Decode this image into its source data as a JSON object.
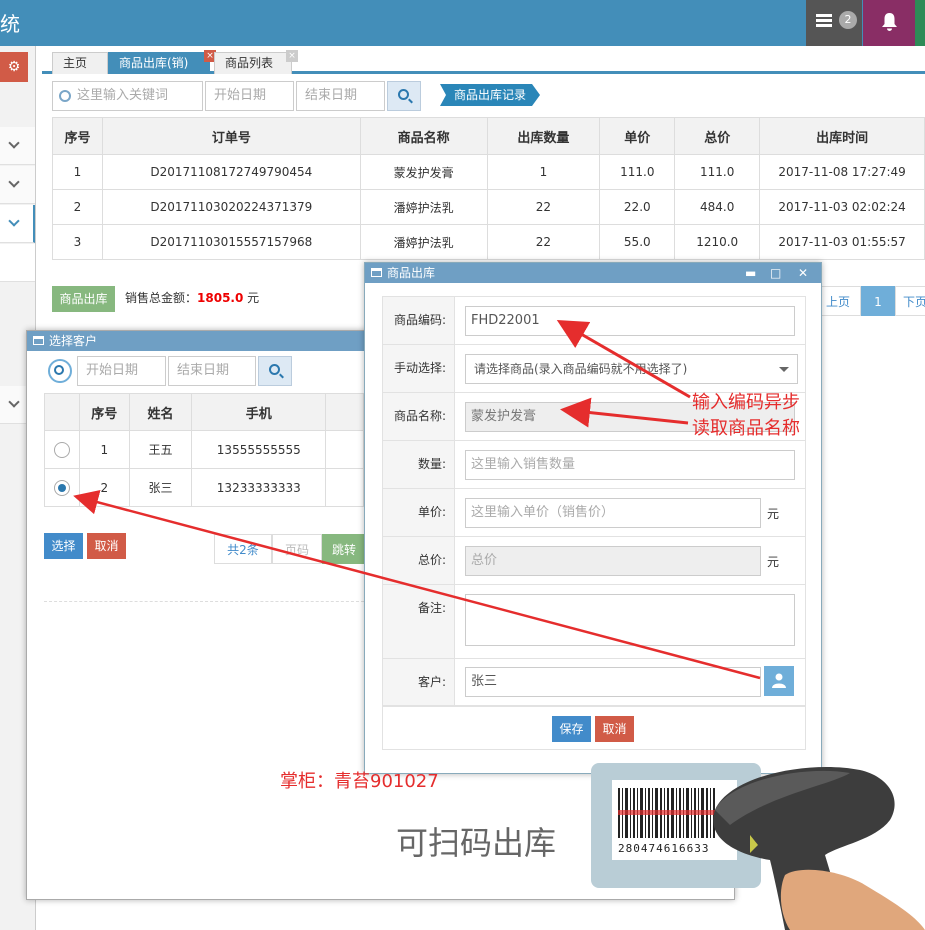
{
  "header": {
    "title": "统",
    "msg_badge": "2"
  },
  "tabs": [
    {
      "label": "主页"
    },
    {
      "label": "商品出库(销)"
    },
    {
      "label": "商品列表"
    }
  ],
  "search": {
    "keyword_placeholder": "这里输入关键词",
    "start_placeholder": "开始日期",
    "end_placeholder": "结束日期",
    "record_tag": "商品出库记录"
  },
  "main_table": {
    "headers": [
      "序号",
      "订单号",
      "商品名称",
      "出库数量",
      "单价",
      "总价",
      "出库时间"
    ],
    "rows": [
      [
        "1",
        "D20171108172749790454",
        "蒙发护发膏",
        "1",
        "111.0",
        "111.0",
        "2017-11-08 17:27:49"
      ],
      [
        "2",
        "D20171103020224371379",
        "潘婷护法乳",
        "22",
        "22.0",
        "484.0",
        "2017-11-03 02:02:24"
      ],
      [
        "3",
        "D20171103015557157968",
        "潘婷护法乳",
        "22",
        "55.0",
        "1210.0",
        "2017-11-03 01:55:57"
      ]
    ]
  },
  "out_button": "商品出库",
  "sum": {
    "label": "销售总金额：",
    "value": "1805.0",
    "unit": "元"
  },
  "pager_main": {
    "prev": "上页",
    "page": "1",
    "next": "下页"
  },
  "customer_dialog": {
    "title": "选择客户",
    "start_placeholder": "开始日期",
    "end_placeholder": "结束日期",
    "headers": [
      "序号",
      "姓名",
      "手机"
    ],
    "rows": [
      [
        "1",
        "王五",
        "13555555555"
      ],
      [
        "2",
        "张三",
        "13233333333"
      ]
    ],
    "select": "选择",
    "cancel": "取消",
    "total": "共2条",
    "page_placeholder": "页码",
    "jump": "跳转"
  },
  "goods_dialog": {
    "title": "商品出库",
    "code_label": "商品编码:",
    "code_value": "FHD22001",
    "manual_label": "手动选择:",
    "manual_value": "请选择商品(录入商品编码就不用选择了)",
    "name_label": "商品名称:",
    "name_value": "蒙发护发膏",
    "qty_label": "数量:",
    "qty_placeholder": "这里输入销售数量",
    "price_label": "单价:",
    "price_placeholder": "这里输入单价（销售价）",
    "price_unit": "元",
    "total_label": "总价:",
    "total_placeholder": "总价",
    "total_unit": "元",
    "remark_label": "备注:",
    "customer_label": "客户:",
    "customer_value": "张三",
    "save": "保存",
    "cancel": "取消"
  },
  "annotations": {
    "note_line1": "输入编码异步",
    "note_line2": "读取商品名称",
    "shopkeeper": "掌柜：青苔901027",
    "scan_text": "可扫码出库",
    "barcode_number": "280474616633"
  },
  "colors": {
    "header": "#438eb9",
    "accent_red": "#e52d2d",
    "btn_green": "#87b87f",
    "btn_blue": "#428bca",
    "btn_red": "#d15b47"
  }
}
